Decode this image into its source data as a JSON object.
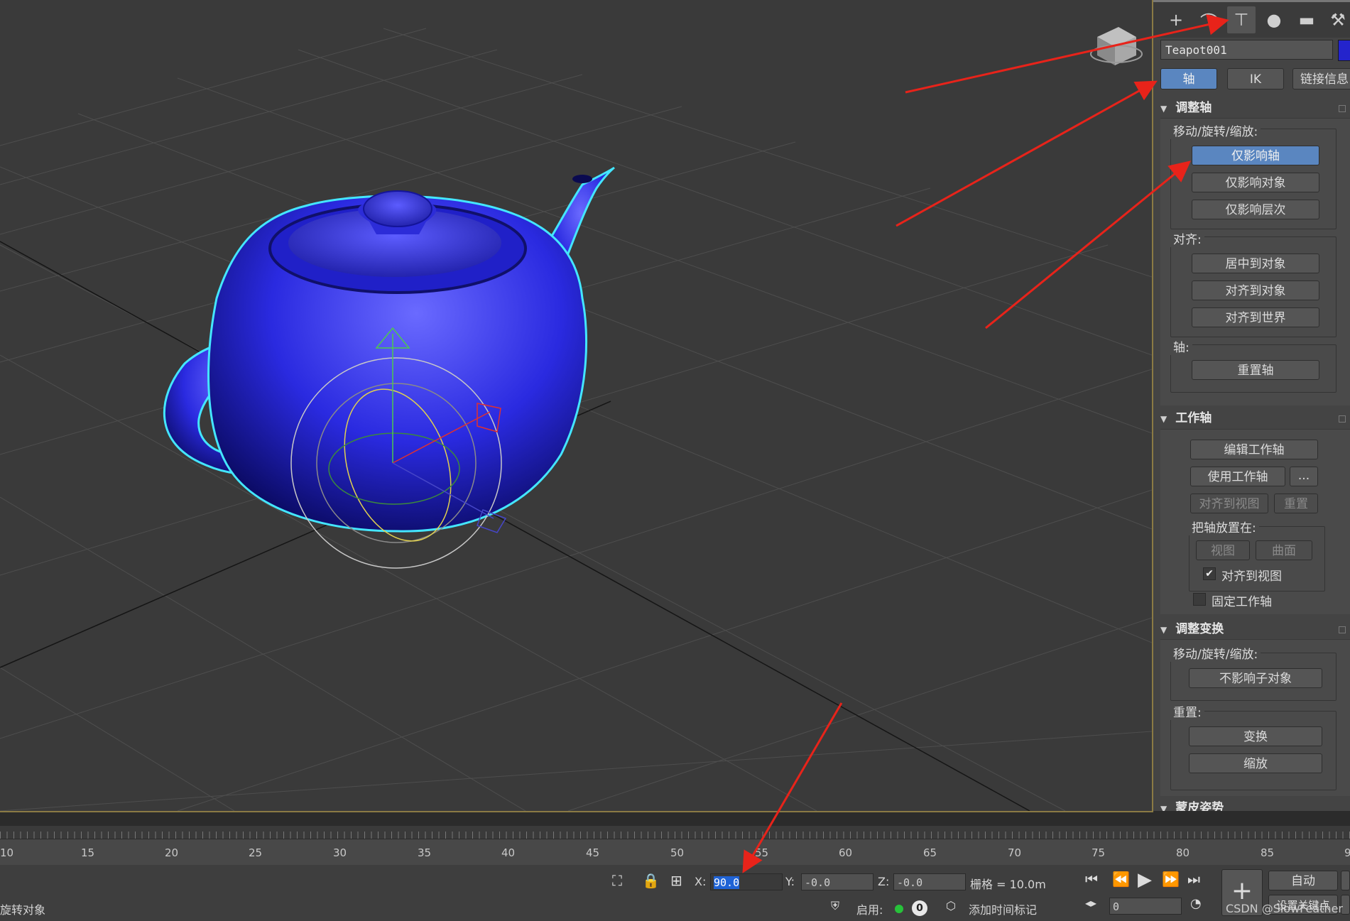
{
  "command_panel": {
    "tabs": [
      {
        "name": "create-tab",
        "icon": "plus-icon",
        "glyph": "+"
      },
      {
        "name": "modify-tab",
        "icon": "modify-curve-icon",
        "glyph": "⌒"
      },
      {
        "name": "hierarchy-tab",
        "icon": "hierarchy-icon",
        "glyph": "⊤"
      },
      {
        "name": "motion-tab",
        "icon": "motion-icon",
        "glyph": "●"
      },
      {
        "name": "display-tab",
        "icon": "display-icon",
        "glyph": "▬"
      },
      {
        "name": "utilities-tab",
        "icon": "wrench-icon",
        "glyph": "⚒"
      }
    ],
    "object_name": "Teapot001",
    "object_color": "#2424cc",
    "mode_buttons": {
      "pivot": "轴",
      "ik": "IK",
      "link_info": "链接信息"
    },
    "adjust_pivot": {
      "title": "调整轴",
      "move_rotate_scale_label": "移动/旋转/缩放:",
      "affect_pivot_only": "仅影响轴",
      "affect_object_only": "仅影响对象",
      "affect_hierarchy_only": "仅影响层次",
      "alignment_label": "对齐:",
      "center_to_object": "居中到对象",
      "align_to_object": "对齐到对象",
      "align_to_world": "对齐到世界",
      "pivot_label": "轴:",
      "reset_pivot": "重置轴"
    },
    "working_pivot": {
      "title": "工作轴",
      "edit_working_pivot": "编辑工作轴",
      "use_working_pivot": "使用工作轴",
      "more": "...",
      "align_to_view": "对齐到视图",
      "reset": "重置",
      "place_pivot_to_label": "把轴放置在:",
      "view": "视图",
      "surface": "曲面",
      "align_to_view_check": "对齐到视图",
      "align_to_view_checked": true,
      "lock_working_pivot": "固定工作轴",
      "lock_working_pivot_checked": false
    },
    "adjust_transform": {
      "title": "调整变换",
      "move_rotate_scale_label": "移动/旋转/缩放:",
      "dont_affect_children": "不影响子对象",
      "reset_label": "重置:",
      "transform": "变换",
      "scale": "缩放"
    },
    "skin_pose": {
      "title": "蒙皮姿势"
    }
  },
  "timeline": {
    "ticks": [
      "10",
      "15",
      "20",
      "25",
      "30",
      "35",
      "40",
      "45",
      "50",
      "55",
      "60",
      "65",
      "70",
      "75",
      "80",
      "85",
      "9"
    ]
  },
  "status_bar": {
    "prompt": "旋转对象",
    "x_label": "X:",
    "x_value": "90.0",
    "y_label": "Y:",
    "y_value": "-0.0",
    "z_label": "Z:",
    "z_value": "-0.0",
    "grid_text": "栅格 = 10.0m",
    "enable_label": "启用:",
    "enable_count": "0",
    "add_time_tag": "添加时间标记",
    "frame_value": "0",
    "auto_key": "自动",
    "set_key": "设置关键点",
    "watermark": "CSDN @SlowFeather"
  }
}
